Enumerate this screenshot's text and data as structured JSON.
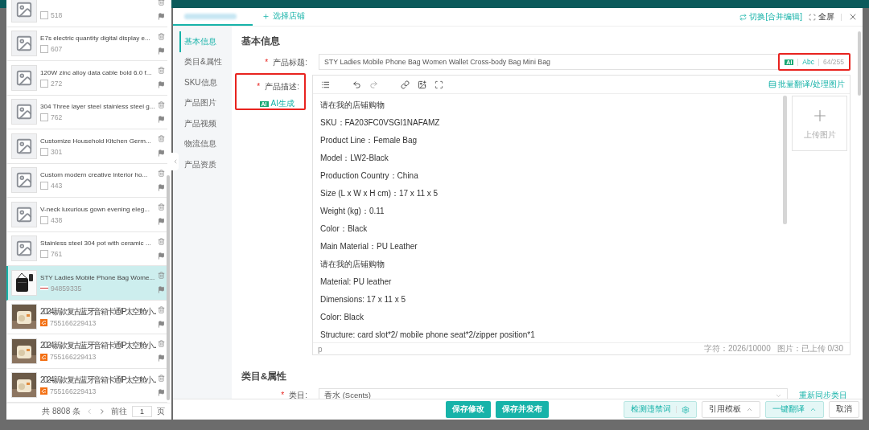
{
  "product_list": {
    "items": [
      {
        "thumb": {
          "kind": "placeholder"
        },
        "badge": {
          "kind": "checkbox"
        },
        "id": "518",
        "selected": false
      },
      {
        "thumb": {
          "kind": "placeholder"
        },
        "title": "E7s electric quantity digital display e...",
        "badge": {
          "kind": "checkbox"
        },
        "id": "607",
        "selected": false
      },
      {
        "thumb": {
          "kind": "placeholder"
        },
        "title": "120W zinc alloy data cable bold 6.0 f...",
        "badge": {
          "kind": "checkbox"
        },
        "id": "272",
        "selected": false
      },
      {
        "thumb": {
          "kind": "placeholder"
        },
        "title": "304 Three layer steel stainless steel g...",
        "badge": {
          "kind": "checkbox"
        },
        "id": "762",
        "selected": false
      },
      {
        "thumb": {
          "kind": "placeholder"
        },
        "title": "Customize Household Kitchen Germ...",
        "badge": {
          "kind": "checkbox"
        },
        "id": "301",
        "selected": false
      },
      {
        "thumb": {
          "kind": "placeholder"
        },
        "title": "Custom modern creative interior ho...",
        "badge": {
          "kind": "checkbox"
        },
        "id": "443",
        "selected": false
      },
      {
        "thumb": {
          "kind": "placeholder"
        },
        "title": "V-neck luxurious gown evening eleg...",
        "badge": {
          "kind": "checkbox"
        },
        "id": "438",
        "selected": false
      },
      {
        "thumb": {
          "kind": "placeholder"
        },
        "title": "Stainless steel 304 pot with ceramic ...",
        "badge": {
          "kind": "checkbox"
        },
        "id": "761",
        "selected": false
      },
      {
        "thumb": {
          "kind": "bag"
        },
        "title": "STY Ladies Mobile Phone Bag Wome...",
        "badge": {
          "kind": "flag"
        },
        "id": "94859335",
        "selected": true
      },
      {
        "thumb": {
          "kind": "speaker"
        },
        "title": "2024新款复古蓝牙音箱卡通IP太空舱小...",
        "badge": {
          "kind": "shop"
        },
        "id": "755166229413",
        "selected": false
      },
      {
        "thumb": {
          "kind": "speaker"
        },
        "title": "2024新款复古蓝牙音箱卡通IP太空舱小...",
        "badge": {
          "kind": "shop"
        },
        "id": "755166229413",
        "selected": false
      },
      {
        "thumb": {
          "kind": "speaker"
        },
        "title": "2024新款复古蓝牙音箱卡通IP太空舱小...",
        "badge": {
          "kind": "shop"
        },
        "id": "755166229413",
        "selected": false
      }
    ],
    "pagination": {
      "total": "共 8808 条",
      "goto": "前往",
      "page": "1",
      "unit": "页"
    }
  },
  "header": {
    "tabs": [
      {
        "kind": "blurred",
        "selected": true
      },
      {
        "kind": "add",
        "label": "选择店铺",
        "selected": false
      }
    ],
    "switch": "切换[合并编辑]",
    "fullscreen": "全屏"
  },
  "nav": [
    {
      "label": "基本信息",
      "selected": true
    },
    {
      "label": "类目&属性",
      "selected": false
    },
    {
      "label": "SKU信息",
      "selected": false
    },
    {
      "label": "产品图片",
      "selected": false
    },
    {
      "label": "产品视频",
      "selected": false
    },
    {
      "label": "物流信息",
      "selected": false
    },
    {
      "label": "产品资质",
      "selected": false
    }
  ],
  "basic_info": {
    "heading": "基本信息",
    "title_field": {
      "required_mark": "*",
      "label": "产品标题:",
      "value": "STY Ladies Mobile Phone Bag Women Wallet Cross-body Bag Mini Bag",
      "ai": "AI",
      "case": "Abc",
      "count": "64/255",
      "highlighted": true
    },
    "description": {
      "required_mark": "*",
      "label": "产品描述:",
      "ai_icon": "AI",
      "ai_button": "AI生成",
      "highlighted": true,
      "batch": "批量翻译/处理图片",
      "lines": [
        "请在我的店铺购物",
        "SKU：FA203FC0VSGI1NAFAMZ",
        "Product Line：Female Bag",
        "Model：LW2-Black",
        "Production Country：China",
        "Size (L x W x H cm)：17 x 11 x 5",
        "Weight (kg)：0.11",
        "Color：Black",
        "Main Material：PU Leather",
        "请在我的店铺购物",
        "Material: PU leather",
        "Dimensions: 17 x 11 x 5",
        "Color: Black",
        "Structure: card slot*2/ mobile phone seat*2/zipper position*1"
      ],
      "upload": "上传图片",
      "path": "p",
      "chars": "字符：2026/10000",
      "images": "图片：已上传 0/30"
    }
  },
  "category": {
    "heading": "类目&属性",
    "required_mark": "*",
    "label": "类目:",
    "value": "香水 (Scents)",
    "resync": "重新同步类目"
  },
  "footer": {
    "save": "保存修改",
    "save_publish": "保存并发布",
    "check": "检测违禁词",
    "template": "引用模板",
    "translate": "一键翻译",
    "cancel": "取消"
  }
}
